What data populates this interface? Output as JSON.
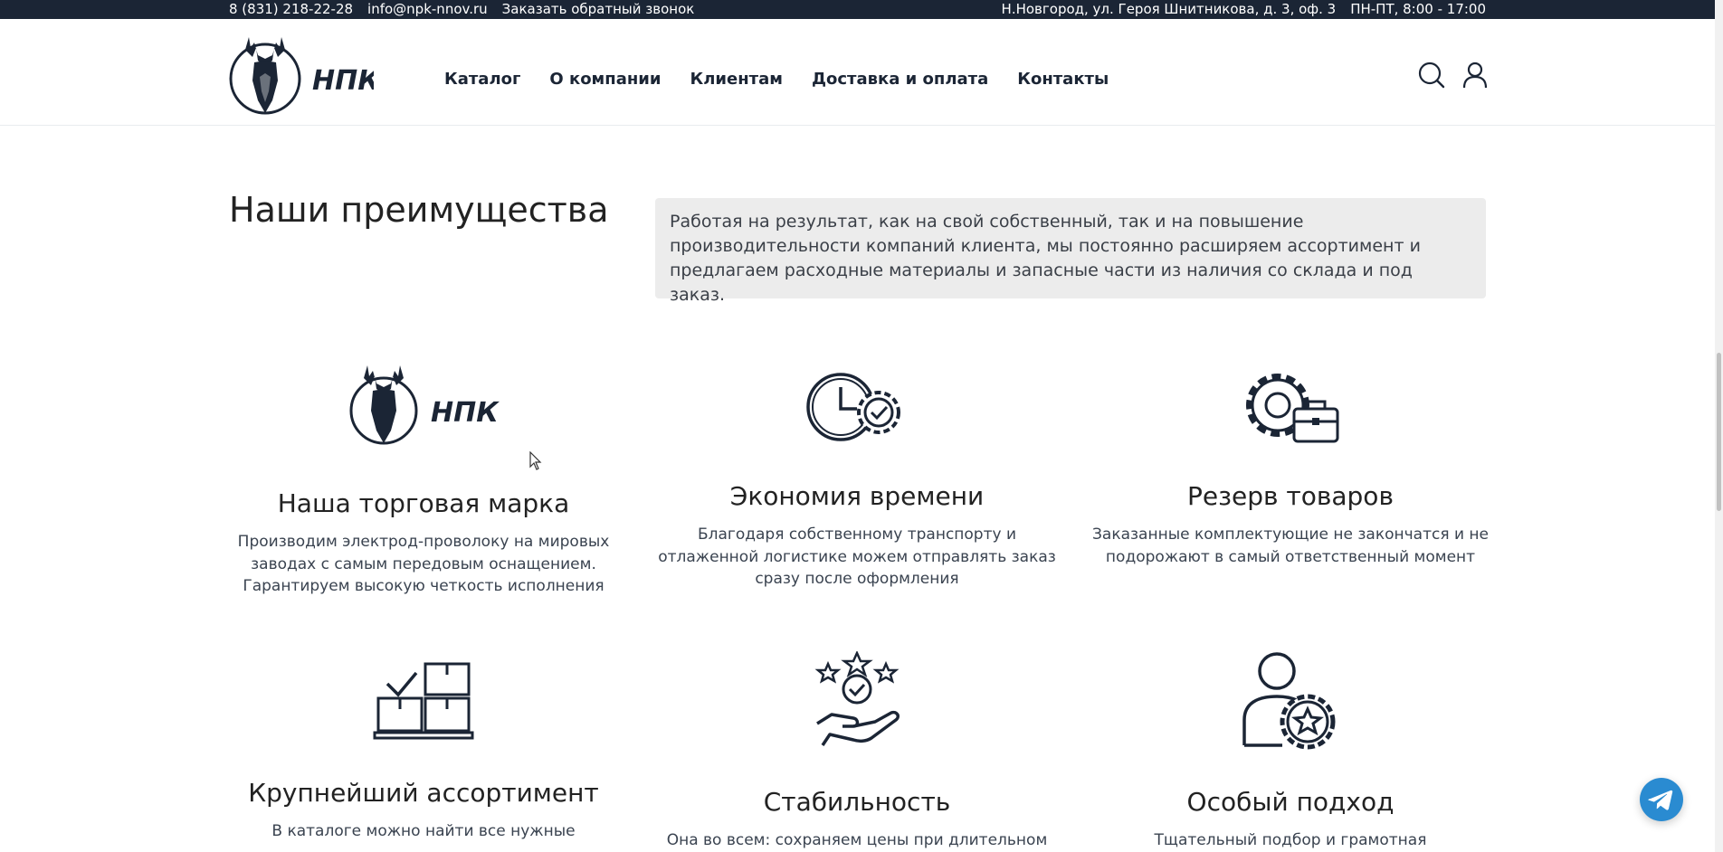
{
  "topbar": {
    "phone": "8 (831) 218-22-28",
    "email": "info@npk-nnov.ru",
    "callback": "Заказать обратный звонок",
    "address": "Н.Новгород, ул. Героя Шнитникова, д. 3, оф. 3",
    "hours": "ПН-ПТ, 8:00 - 17:00"
  },
  "logo": {
    "text": "НПК"
  },
  "nav": [
    {
      "label": "Каталог"
    },
    {
      "label": "О компании"
    },
    {
      "label": "Клиентам"
    },
    {
      "label": "Доставка и оплата"
    },
    {
      "label": "Контакты"
    }
  ],
  "section": {
    "title": "Наши преимущества",
    "intro": "Работая на результат, как на свой собственный, так и на повышение производительности компаний клиента, мы постоянно расширяем ассортимент и предлагаем расходные материалы и запасные части из наличия со склада и под заказ."
  },
  "features": [
    {
      "title": "Наша торговая марка",
      "text": "Производим электрод-проволоку на мировых заводах с самым передовым оснащением. Гарантируем высокую четкость исполнения",
      "icon": "brand-logo-icon"
    },
    {
      "title": "Экономия времени",
      "text": "Благодаря собственному транспорту и отлаженной логистике можем отправлять заказ сразу после оформления",
      "icon": "clock-gear-icon"
    },
    {
      "title": "Резерв товаров",
      "text": "Заказанные комплектующие не закончатся и не подорожают в самый ответственный момент",
      "icon": "gear-briefcase-icon"
    },
    {
      "title": "Крупнейший ассортимент",
      "text": "В каталоге можно найти все нужные",
      "icon": "boxes-icon"
    },
    {
      "title": "Стабильность",
      "text": "Она во всем: сохраняем цены при длительном",
      "icon": "hand-stars-icon"
    },
    {
      "title": "Особый подход",
      "text": "Тщательный подбор и грамотная",
      "icon": "user-star-icon"
    }
  ],
  "colors": {
    "topbar": "#1b2535",
    "accent": "#1b2535",
    "telegram": "#2a8bd1",
    "intro_bg": "#ececec"
  }
}
